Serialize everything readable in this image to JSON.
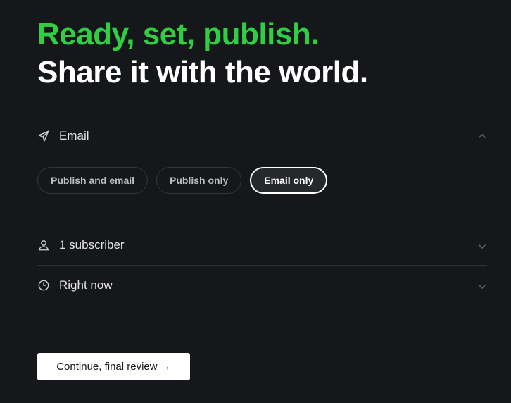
{
  "headline": {
    "line1": "Ready, set, publish.",
    "line2": "Share it with the world."
  },
  "email_section": {
    "label": "Email",
    "icon": "send-icon",
    "expanded": true,
    "options": [
      {
        "label": "Publish and email",
        "selected": false
      },
      {
        "label": "Publish only",
        "selected": false
      },
      {
        "label": "Email only",
        "selected": true
      }
    ]
  },
  "audience_section": {
    "label": "1 subscriber",
    "icon": "user-icon"
  },
  "schedule_section": {
    "label": "Right now",
    "icon": "clock-icon"
  },
  "cta": {
    "label": "Continue, final review →"
  },
  "colors": {
    "background": "#15171a",
    "accent_green": "#30cf43",
    "text_white": "#ffffff"
  }
}
